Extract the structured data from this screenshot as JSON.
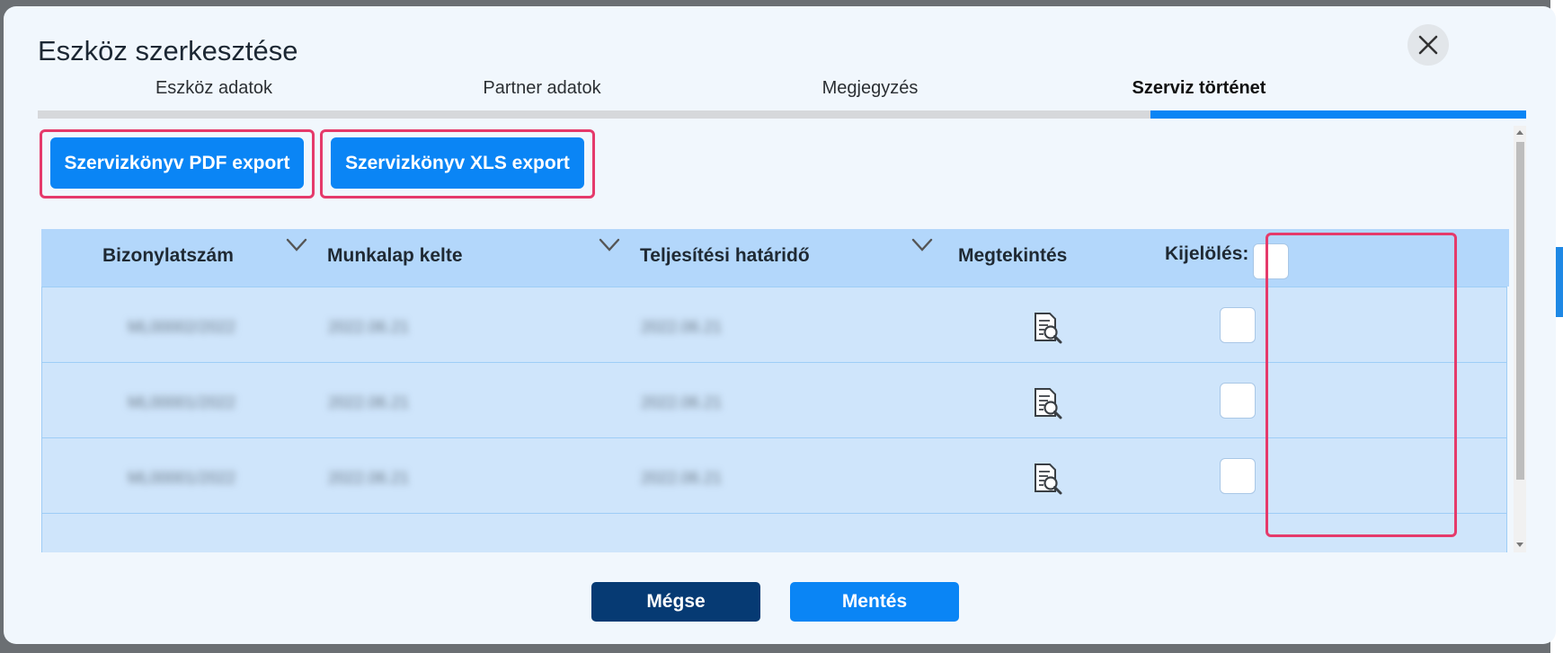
{
  "dialog": {
    "title": "Eszköz szerkesztése"
  },
  "tabs": [
    {
      "label": "Eszköz adatok",
      "active": false
    },
    {
      "label": "Partner adatok",
      "active": false
    },
    {
      "label": "Megjegyzés",
      "active": false
    },
    {
      "label": "Szerviz történet",
      "active": true
    }
  ],
  "actions": {
    "pdf_export": "Szervizkönyv PDF export",
    "xls_export": "Szervizkönyv XLS export"
  },
  "table": {
    "columns": [
      "Bizonylatszám",
      "Munkalap kelte",
      "Teljesítési határidő",
      "Megtekintés",
      "Kijelölés:"
    ],
    "rows": [
      {
        "number": "ML00002/2022",
        "date": "2022.06.21",
        "deadline": "2022.06.21",
        "selected": false
      },
      {
        "number": "ML00001/2022",
        "date": "2022.06.21",
        "deadline": "2022.06.21",
        "selected": false
      },
      {
        "number": "ML00001/2022",
        "date": "2022.06.21",
        "deadline": "2022.06.21",
        "selected": false
      }
    ]
  },
  "footer": {
    "cancel": "Mégse",
    "save": "Mentés"
  },
  "colors": {
    "primary": "#0a85f5",
    "dark_button": "#063a73",
    "highlight": "#e53a6b",
    "header_bg": "#b3d7fb",
    "row_bg": "#cfe5fb"
  },
  "icons": {
    "close": "close-icon",
    "sort": "chevron-down-icon",
    "view": "document-search-icon"
  }
}
